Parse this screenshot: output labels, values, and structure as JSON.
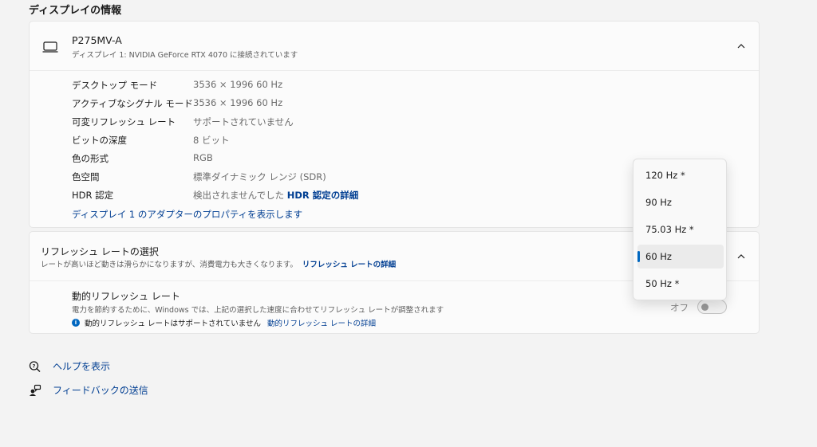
{
  "section_title": "ディスプレイの情報",
  "display": {
    "name": "P275MV-A",
    "subtitle": "ディスプレイ 1: NVIDIA GeForce RTX 4070 に接続されています",
    "rows": [
      {
        "label": "デスクトップ モード",
        "value": "3536 × 1996 60 Hz"
      },
      {
        "label": "アクティブなシグナル モード",
        "value": "3536 × 1996 60 Hz"
      },
      {
        "label": "可変リフレッシュ レート",
        "value": "サポートされていません"
      },
      {
        "label": "ビットの深度",
        "value": "8 ビット"
      },
      {
        "label": "色の形式",
        "value": "RGB"
      },
      {
        "label": "色空間",
        "value": "標準ダイナミック レンジ (SDR)"
      }
    ],
    "hdr_label": "HDR 認定",
    "hdr_value": "検出されませんでした",
    "hdr_link": "HDR 認定の詳細",
    "adapter_link": "ディスプレイ 1 のアダプターのプロパティを表示します"
  },
  "refresh": {
    "title": "リフレッシュ レートの選択",
    "subtitle": "レートが高いほど動きは滑らかになりますが、消費電力も大きくなります。",
    "subtitle_link": "リフレッシュ レートの詳細"
  },
  "dynamic": {
    "title": "動的リフレッシュ レート",
    "subtitle": "電力を節約するために、Windows では、上記の選択した速度に合わせてリフレッシュ レートが調整されます",
    "note": "動的リフレッシュ レートはサポートされていません",
    "note_link": "動的リフレッシュ レートの詳細",
    "toggle_label": "オフ",
    "toggle_on": false
  },
  "footer": {
    "help": "ヘルプを表示",
    "feedback": "フィードバックの送信"
  },
  "dropdown": {
    "options": [
      "120 Hz *",
      "90 Hz",
      "75.03 Hz *",
      "60 Hz",
      "50 Hz *"
    ],
    "selected": "60 Hz"
  },
  "colors": {
    "accent": "#0067c0",
    "link": "#003e92",
    "background": "#f3f3f3",
    "card": "#fbfbfb"
  }
}
